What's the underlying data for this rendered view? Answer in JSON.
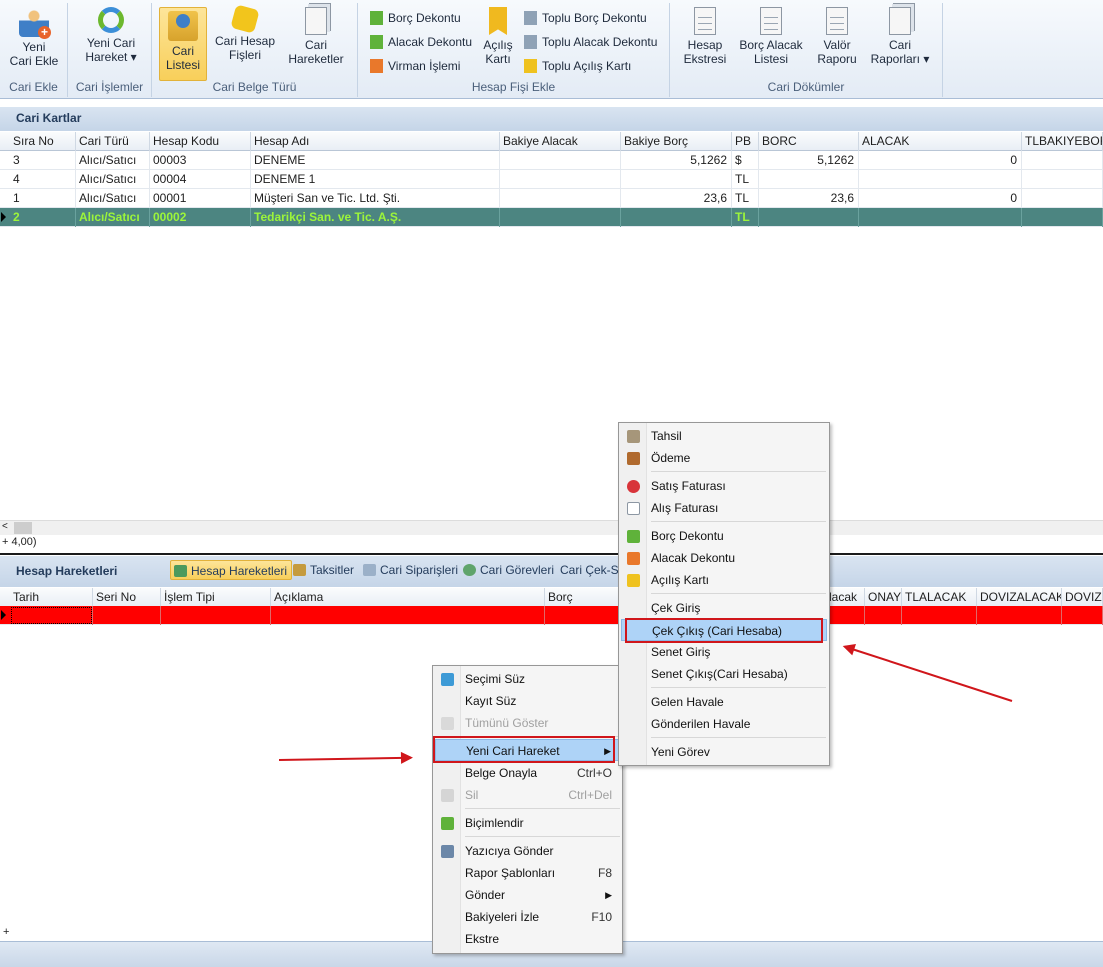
{
  "ribbon": {
    "groups": [
      {
        "caption": "Cari Ekle",
        "buttons": [
          {
            "label": "Yeni\nCari Ekle"
          }
        ]
      },
      {
        "caption": "Cari İşlemler",
        "buttons": [
          {
            "label": "Yeni Cari\nHareket ▾"
          }
        ]
      },
      {
        "caption": "Cari Belge Türü",
        "buttons": [
          {
            "label": "Cari\nListesi"
          },
          {
            "label": "Cari Hesap\nFişleri"
          },
          {
            "label": "Cari\nHareketler"
          }
        ]
      },
      {
        "caption": "Hesap Fişi Ekle",
        "small": [
          "Borç Dekontu",
          "Alacak Dekontu",
          "Virman İşlemi",
          "Toplu Borç Dekontu",
          "Toplu Alacak Dekontu",
          "Toplu Açılış Kartı"
        ],
        "big": "Açılış\nKartı"
      },
      {
        "caption": "Cari Dökümler",
        "buttons": [
          {
            "label": "Hesap\nEkstresi"
          },
          {
            "label": "Borç Alacak\nListesi"
          },
          {
            "label": "Valör\nRaporu"
          },
          {
            "label": "Cari\nRaporları ▾"
          }
        ]
      }
    ]
  },
  "cari_kartlar": {
    "title": "Cari Kartlar",
    "columns": [
      "Sıra No",
      "Cari Türü",
      "Hesap Kodu",
      "Hesap Adı",
      "Bakiye Alacak",
      "Bakiye Borç",
      "PB",
      "BORC",
      "ALACAK",
      "TLBAKIYEBOR"
    ],
    "rows": [
      [
        "3",
        "Alıcı/Satıcı",
        "00003",
        "DENEME",
        "",
        "5,1262",
        "$",
        "5,1262",
        "0",
        ""
      ],
      [
        "4",
        "Alıcı/Satıcı",
        "00004",
        "DENEME 1",
        "",
        "",
        "TL",
        "",
        "",
        ""
      ],
      [
        "1",
        "Alıcı/Satıcı",
        "00001",
        "Müşteri San ve Tic. Ltd. Şti.",
        "",
        "23,6",
        "TL",
        "23,6",
        "0",
        ""
      ],
      [
        "2",
        "Alıcı/Satıcı",
        "00002",
        "Tedarikçi San. ve Tic. A.Ş.",
        "",
        "",
        "TL",
        "",
        "",
        ""
      ]
    ],
    "footer": "4,00)"
  },
  "hesap_hareketleri": {
    "title": "Hesap Hareketleri",
    "tabs": [
      "Hesap Hareketleri",
      "Taksitler",
      "Cari Siparişleri",
      "Cari Görevleri",
      "Cari Çek-S"
    ],
    "columns": [
      "Tarih",
      "Seri No",
      "İşlem Tipi",
      "Açıklama",
      "Borç",
      "lacak",
      "ONAY",
      "TLALACAK",
      "DOVIZALACAK",
      "DOVIZ"
    ]
  },
  "context_menu": [
    {
      "label": "Seçimi Süz",
      "icon": "filter-icon"
    },
    {
      "label": "Kayıt Süz"
    },
    {
      "label": "Tümünü Göster",
      "disabled": true,
      "icon": "show-all-icon"
    },
    {
      "label": "Yeni Cari Hareket",
      "submenu": true,
      "highlighted": true
    },
    {
      "label": "Belge Onayla",
      "shortcut": "Ctrl+O"
    },
    {
      "label": "Sil",
      "shortcut": "Ctrl+Del",
      "disabled": true,
      "icon": "delete-icon"
    },
    {
      "label": "Biçimlendir",
      "icon": "format-icon"
    },
    {
      "label": "Yazıcıya Gönder",
      "icon": "printer-icon"
    },
    {
      "label": "Rapor Şablonları",
      "shortcut": "F8"
    },
    {
      "label": "Gönder",
      "submenu": true
    },
    {
      "label": "Bakiyeleri İzle",
      "shortcut": "F10"
    },
    {
      "label": "Ekstre"
    }
  ],
  "submenu": [
    {
      "label": "Tahsil"
    },
    {
      "label": "Ödeme"
    },
    {
      "label": "Satış Faturası"
    },
    {
      "label": "Alış Faturası"
    },
    {
      "label": "Borç Dekontu"
    },
    {
      "label": "Alacak Dekontu"
    },
    {
      "label": "Açılış Kartı"
    },
    {
      "label": "Çek Giriş"
    },
    {
      "label": "Çek Çıkış (Cari Hesaba)",
      "highlighted": true
    },
    {
      "label": "Senet Giriş"
    },
    {
      "label": "Senet Çıkış(Cari Hesaba)"
    },
    {
      "label": "Gelen Havale"
    },
    {
      "label": "Gönderilen Havale"
    },
    {
      "label": "Yeni Görev"
    }
  ],
  "colors": {
    "selected_row": "#4c8581",
    "selected_text": "#9cf53a",
    "error_row": "#ff0000",
    "annotation": "#d0161b"
  }
}
